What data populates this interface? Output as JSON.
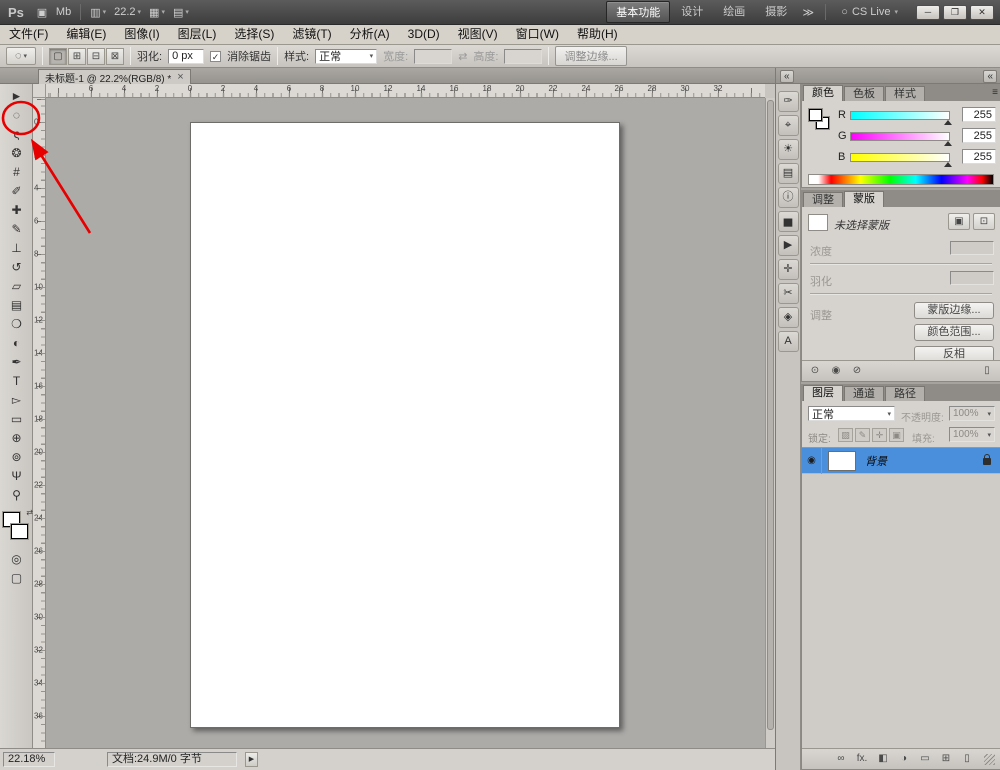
{
  "colors": {
    "selection_blue": "#4a8fdc",
    "annotation_red": "#e60000",
    "workspace_highlight": "#6e6e6e"
  },
  "app_bar": {
    "logo": "Ps",
    "bridge_glyph": "▣",
    "mini_bridge_glyph": "Mb",
    "extras_glyph": "▥",
    "zoom_value": "22.2",
    "arrange_glyph": "▦",
    "screen_glyph": "▤",
    "workspaces": [
      "基本功能",
      "设计",
      "绘画",
      "摄影"
    ],
    "active_workspace": "基本功能",
    "more_glyph": "≫",
    "cs_live_glyph": "○",
    "cs_live_label": "CS Live",
    "minimize_glyph": "─",
    "restore_glyph": "❐",
    "close_glyph": "✕"
  },
  "menu_bar": {
    "items": [
      "文件(F)",
      "编辑(E)",
      "图像(I)",
      "图层(L)",
      "选择(S)",
      "滤镜(T)",
      "分析(A)",
      "3D(D)",
      "视图(V)",
      "窗口(W)",
      "帮助(H)"
    ]
  },
  "options_bar": {
    "tool_glyph": "◌",
    "combine_modes": [
      {
        "name": "new-selection-icon",
        "glyph": "▢"
      },
      {
        "name": "add-to-selection-icon",
        "glyph": "⊞"
      },
      {
        "name": "subtract-from-selection-icon",
        "glyph": "⊟"
      },
      {
        "name": "intersect-selection-icon",
        "glyph": "⊠"
      }
    ],
    "feather_label": "羽化:",
    "feather_value": "0 px",
    "antialias_check": "✓",
    "antialias_label": "消除锯齿",
    "style_label": "样式:",
    "style_value": "正常",
    "width_label": "宽度:",
    "swap_glyph": "⇄",
    "height_label": "高度:",
    "refine_edge_label": "调整边缘..."
  },
  "document_tab": {
    "title": "未标题-1 @ 22.2%(RGB/8) *",
    "close_glyph": "×"
  },
  "toolbar": {
    "tools": [
      {
        "name": "move-tool",
        "glyph": "►"
      },
      {
        "name": "marquee-tool",
        "glyph": "◌"
      },
      {
        "name": "lasso-tool",
        "glyph": "ς"
      },
      {
        "name": "quick-selection-tool",
        "glyph": "❂"
      },
      {
        "name": "crop-tool",
        "glyph": "#"
      },
      {
        "name": "eyedropper-tool",
        "glyph": "✐"
      },
      {
        "name": "healing-brush-tool",
        "glyph": "✚"
      },
      {
        "name": "brush-tool",
        "glyph": "✎"
      },
      {
        "name": "clone-stamp-tool",
        "glyph": "⊥"
      },
      {
        "name": "history-brush-tool",
        "glyph": "↺"
      },
      {
        "name": "eraser-tool",
        "glyph": "▱"
      },
      {
        "name": "gradient-tool",
        "glyph": "▤"
      },
      {
        "name": "blur-tool",
        "glyph": "❍"
      },
      {
        "name": "dodge-tool",
        "glyph": "◐"
      },
      {
        "name": "pen-tool",
        "glyph": "✒"
      },
      {
        "name": "type-tool",
        "glyph": "T"
      },
      {
        "name": "path-selection-tool",
        "glyph": "▻"
      },
      {
        "name": "shape-tool",
        "glyph": "▭"
      },
      {
        "name": "3d-rotate-tool",
        "glyph": "⊕"
      },
      {
        "name": "3d-orbit-tool",
        "glyph": "⊚"
      },
      {
        "name": "hand-tool",
        "glyph": "Ψ"
      },
      {
        "name": "zoom-tool",
        "glyph": "⚲"
      }
    ],
    "swap_glyph": "⇄",
    "extras": [
      {
        "name": "quick-mask-button",
        "glyph": "◎"
      },
      {
        "name": "screen-mode-button",
        "glyph": "▢"
      }
    ]
  },
  "rulers": {
    "horizontal": [
      "6",
      "4",
      "2",
      "0",
      "2",
      "4",
      "6",
      "8",
      "10",
      "12",
      "14",
      "16",
      "18",
      "20",
      "22",
      "24",
      "26",
      "28",
      "30",
      "32"
    ],
    "vertical": [
      "0",
      "2",
      "4",
      "6",
      "8",
      "10",
      "12",
      "14",
      "16",
      "18",
      "20",
      "22",
      "24",
      "26",
      "28",
      "30",
      "32",
      "34",
      "36"
    ]
  },
  "dock_strip": {
    "collapse_glyph": "«",
    "icons": [
      {
        "name": "brush-presets-icon",
        "glyph": "✑"
      },
      {
        "name": "clone-source-icon",
        "glyph": "⌖"
      },
      {
        "name": "adjustments-icon",
        "glyph": "☀"
      },
      {
        "name": "styles-icon",
        "glyph": "▤"
      },
      {
        "name": "info-icon",
        "glyph": "ⓘ"
      },
      {
        "name": "histogram-icon",
        "glyph": "▅"
      },
      {
        "name": "actions-icon",
        "glyph": "▶"
      },
      {
        "name": "tool-presets-icon",
        "glyph": "✛"
      },
      {
        "name": "scissors-icon",
        "glyph": "✂"
      },
      {
        "name": "navigator-icon",
        "glyph": "◈"
      },
      {
        "name": "character-icon",
        "glyph": "A"
      }
    ]
  },
  "icons": {
    "panel_menu": "≡"
  },
  "color_panel": {
    "tabs": [
      "颜色",
      "色板",
      "样式"
    ],
    "active_tab": "颜色",
    "channels": [
      {
        "label": "R",
        "value": "255"
      },
      {
        "label": "G",
        "value": "255"
      },
      {
        "label": "B",
        "value": "255"
      }
    ]
  },
  "masks_panel": {
    "tabs": [
      "调整",
      "蒙版"
    ],
    "active_tab": "蒙版",
    "status_text": "未选择蒙版",
    "pixel_mask_glyph": "▣",
    "vector_mask_glyph": "⊡",
    "density_label": "浓度",
    "feather_label": "羽化",
    "adjust_label": "调整",
    "buttons": [
      "蒙版边缘...",
      "颜色范围...",
      "反相"
    ],
    "footer_icons": [
      {
        "name": "load-selection-icon",
        "glyph": "⊙"
      },
      {
        "name": "apply-mask-icon",
        "glyph": "◉"
      },
      {
        "name": "disable-mask-icon",
        "glyph": "⊘"
      }
    ],
    "delete_glyph": "▯"
  },
  "layers_panel": {
    "tabs": [
      "图层",
      "通道",
      "路径"
    ],
    "active_tab": "图层",
    "blend_mode": "正常",
    "opacity_label": "不透明度:",
    "opacity_value": "100%",
    "lock_label": "锁定:",
    "lock_icons": [
      {
        "name": "lock-transparency-icon",
        "glyph": "▨"
      },
      {
        "name": "lock-paint-icon",
        "glyph": "✎"
      },
      {
        "name": "lock-position-icon",
        "glyph": "✛"
      },
      {
        "name": "lock-all-icon",
        "glyph": "▣"
      }
    ],
    "fill_label": "填充:",
    "fill_value": "100%",
    "eye_glyph": "◉",
    "layers": [
      {
        "name": "背景",
        "visible": true,
        "locked": true,
        "selected": true
      }
    ],
    "footer_icons": [
      {
        "name": "link-layers-icon",
        "glyph": "∞"
      },
      {
        "name": "layer-effects-icon",
        "glyph": "fx."
      },
      {
        "name": "add-mask-icon",
        "glyph": "◧"
      },
      {
        "name": "adjustment-layer-icon",
        "glyph": "◑"
      },
      {
        "name": "new-group-icon",
        "glyph": "▭"
      },
      {
        "name": "new-layer-icon",
        "glyph": "⊞"
      },
      {
        "name": "delete-layer-icon",
        "glyph": "▯"
      }
    ]
  },
  "status_bar": {
    "zoom": "22.18%",
    "doc_info": "文档:24.9M/0 字节",
    "expand_glyph": "▶"
  }
}
